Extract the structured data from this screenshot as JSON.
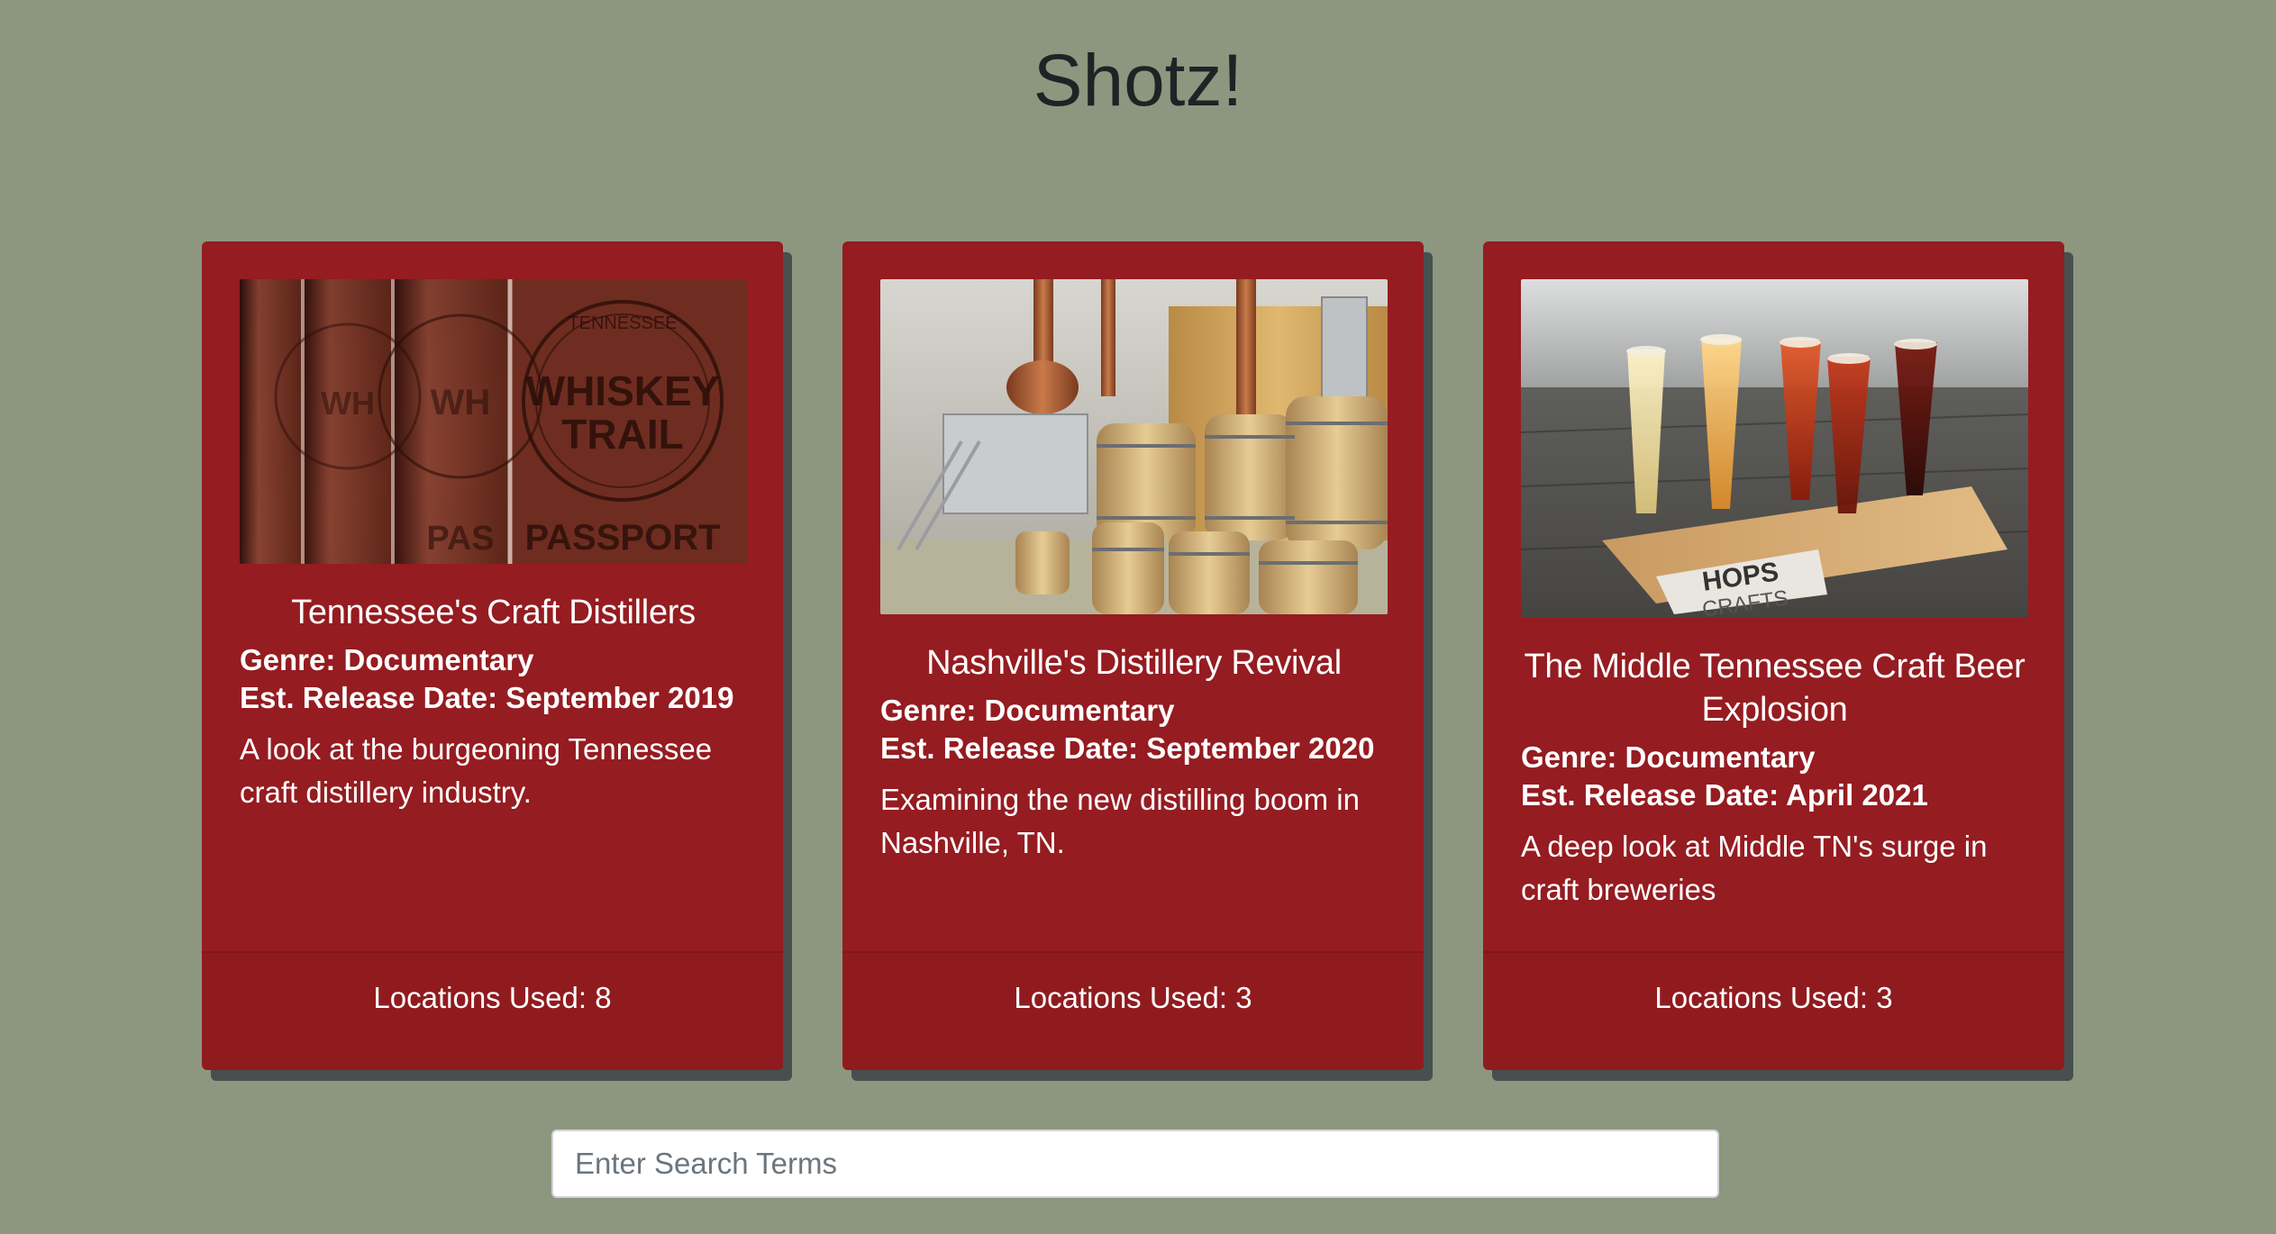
{
  "header": {
    "title": "Shotz!"
  },
  "cards": [
    {
      "title": "Tennessee's Craft Distillers",
      "genre": "Genre: Documentary",
      "release": "Est. Release Date: September 2019",
      "description": "A look at the burgeoning Tennessee craft distillery industry.",
      "locations": "Locations Used: 8",
      "image_icon": "whiskey-trail-passport-image",
      "image_text_1": "TENNESSEE",
      "image_text_2": "WHISKEY",
      "image_text_3": "TRAIL",
      "image_text_4": "PASSPORT"
    },
    {
      "title": "Nashville's Distillery Revival",
      "genre": "Genre: Documentary",
      "release": "Est. Release Date: September 2020",
      "description": "Examining the new distilling boom in Nashville, TN.",
      "locations": "Locations Used: 3",
      "image_icon": "distillery-barrels-image"
    },
    {
      "title": "The Middle Tennessee Craft Beer Explosion",
      "genre": "Genre: Documentary",
      "release": "Est. Release Date: April 2021",
      "description": "A deep look at Middle TN's surge in craft breweries",
      "locations": "Locations Used: 3",
      "image_icon": "beer-flight-image",
      "image_text_1": "HOPS",
      "image_text_2": "CRAFTS"
    }
  ],
  "search": {
    "placeholder": "Enter Search Terms",
    "value": ""
  },
  "colors": {
    "background": "#8d977f",
    "card": "#951c21",
    "shadow": "#47504f",
    "title_text": "#1f2326"
  }
}
